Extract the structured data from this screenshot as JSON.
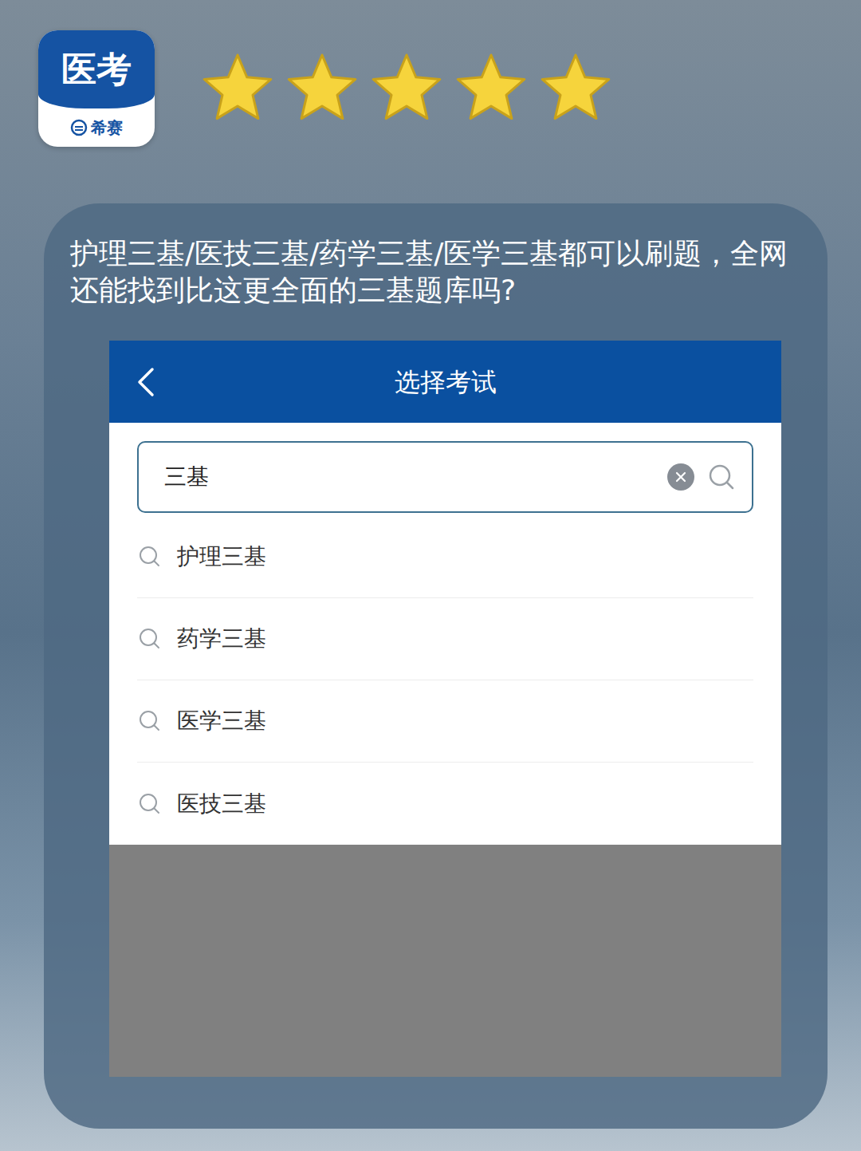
{
  "app": {
    "logo_title": "医考",
    "logo_brand": "希赛",
    "stars": 5
  },
  "caption": "护理三基/医技三基/药学三基/医学三基都可以刷题，全网还能找到比这更全面的三基题库吗?",
  "screen": {
    "title": "选择考试",
    "search": {
      "value": "三基"
    },
    "results": [
      {
        "label": "护理三基"
      },
      {
        "label": "药学三基"
      },
      {
        "label": "医学三基"
      },
      {
        "label": "医技三基"
      }
    ]
  }
}
